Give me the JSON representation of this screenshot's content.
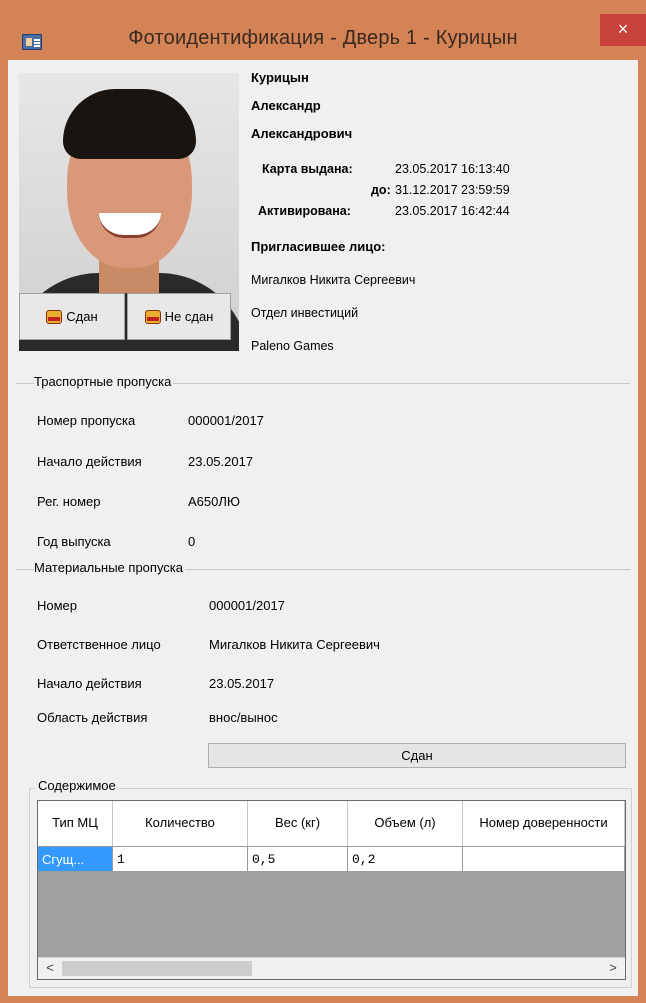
{
  "window": {
    "title": "Фотоидентификация - Дверь 1 - Курицын",
    "close_glyph": "×"
  },
  "person": {
    "last_name": "Курицын",
    "first_name": "Александр",
    "patronymic": "Александрович",
    "card_issued_label": "Карта выдана:",
    "card_issued_value": "23.05.2017 16:13:40",
    "until_label": "до:",
    "until_value": "31.12.2017 23:59:59",
    "activated_label": "Активирована:",
    "activated_value": "23.05.2017 16:42:44",
    "inviter_label": "Пригласившее лицо:",
    "inviter_name": "Мигалков Никита Сергеевич",
    "inviter_department": "Отдел инвестиций",
    "inviter_company": "Paleno Games"
  },
  "photo_buttons": {
    "returned": "Сдан",
    "not_returned": "Не сдан"
  },
  "transport": {
    "group_label": "Траспортные пропуска",
    "rows": [
      {
        "label": "Номер пропуска",
        "value": "000001/2017"
      },
      {
        "label": "Начало действия",
        "value": "23.05.2017"
      },
      {
        "label": "Рег. номер",
        "value": "А650ЛЮ"
      },
      {
        "label": "Год выпуска",
        "value": "0"
      }
    ]
  },
  "material": {
    "group_label": "Материальные пропуска",
    "rows": [
      {
        "label": "Номер",
        "value": "000001/2017"
      },
      {
        "label": "Ответственное лицо",
        "value": "Мигалков Никита Сергеевич"
      },
      {
        "label": "Начало действия",
        "value": "23.05.2017"
      },
      {
        "label": "Область действия",
        "value": "внос/вынос"
      }
    ],
    "returned_button": "Сдан",
    "contents_label": "Содержимое",
    "columns": [
      "Тип МЦ",
      "Количество",
      "Вес (кг)",
      "Объем (л)",
      "Номер доверенности"
    ],
    "rows_data": [
      {
        "type": "Сгущ...",
        "qty": "1",
        "weight": "0,5",
        "volume": "0,2",
        "proxy": ""
      }
    ],
    "scroll_left": "<",
    "scroll_right": ">"
  }
}
